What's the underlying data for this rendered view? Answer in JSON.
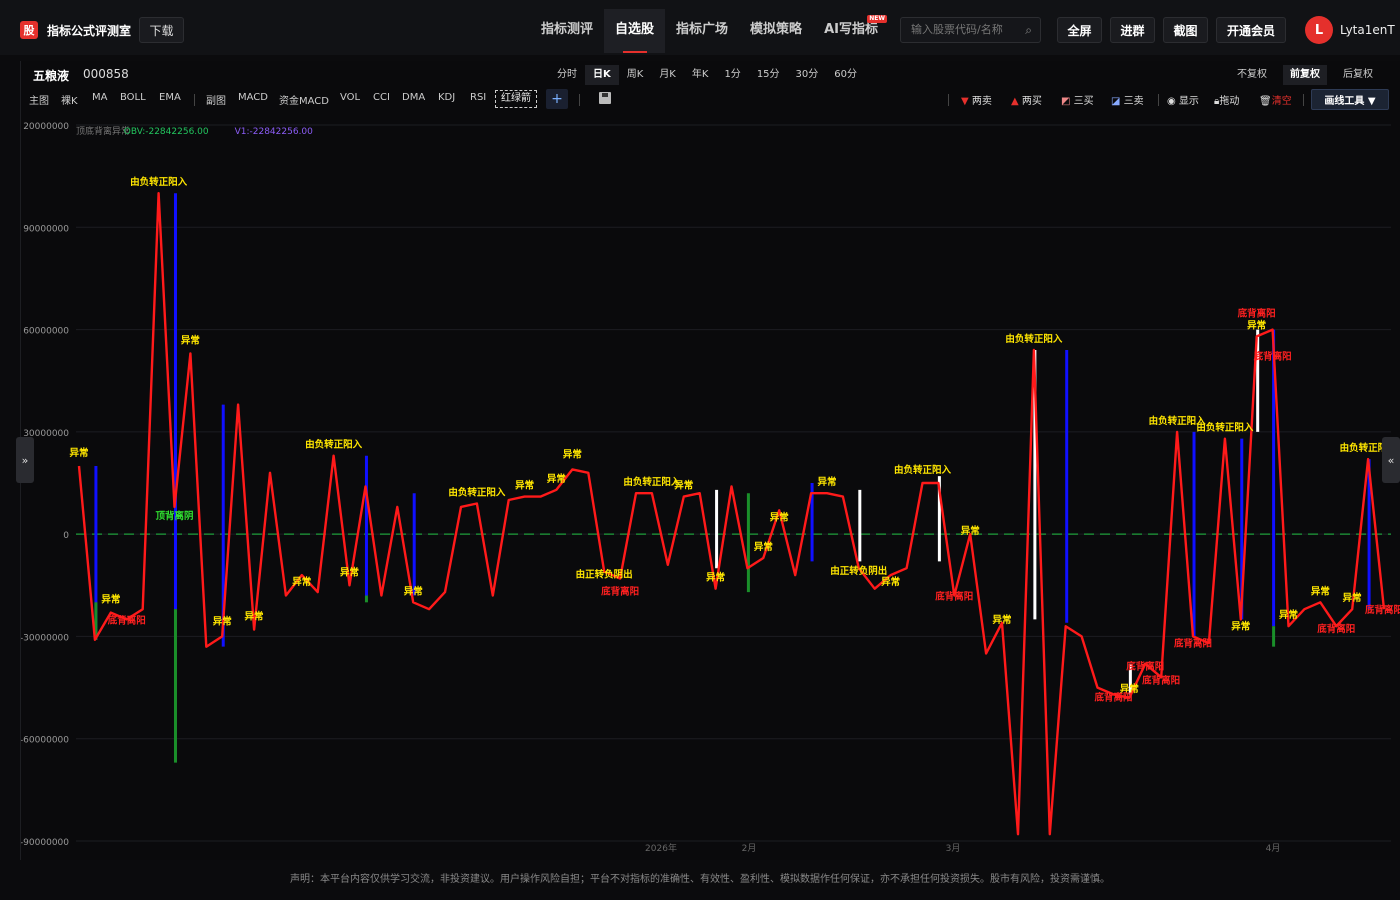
{
  "header": {
    "logo_char": "股",
    "app_title": "指标公式评测室",
    "download": "下载",
    "nav": [
      {
        "label": "指标测评",
        "active": false,
        "badge": ""
      },
      {
        "label": "自选股",
        "active": true,
        "badge": ""
      },
      {
        "label": "指标广场",
        "active": false,
        "badge": ""
      },
      {
        "label": "模拟策略",
        "active": false,
        "badge": ""
      },
      {
        "label": "AI写指标",
        "active": false,
        "badge": "NEW"
      }
    ],
    "search_placeholder": "输入股票代码/名称",
    "fullscreen": "全屏",
    "join_group": "进群",
    "screenshot": "截图",
    "vip": "开通会员",
    "avatar_letter": "L",
    "username": "Lyta1enT"
  },
  "stock": {
    "name": "五粮液",
    "code": "000858"
  },
  "periods": [
    "分时",
    "日K",
    "周K",
    "月K",
    "年K",
    "1分",
    "15分",
    "30分",
    "60分"
  ],
  "active_period": "日K",
  "fq": [
    "不复权",
    "前复权",
    "后复权"
  ],
  "active_fq": "前复权",
  "tools_left": [
    "主图",
    "裸K",
    "MA",
    "BOLL",
    "EMA",
    "副图",
    "MACD",
    "资金MACD",
    "VOL",
    "CCI",
    "DMA",
    "KDJ",
    "RSI"
  ],
  "tool_dashed": "红绿箭",
  "tools_right": {
    "two_sell": "两卖",
    "two_buy": "两买",
    "three_buy": "三买",
    "three_sell": "三卖",
    "show": "显示",
    "drag": "拖动",
    "clear": "清空",
    "draw_tools": "画线工具 ▼"
  },
  "chart_data": {
    "type": "line",
    "legend": [
      {
        "name": "顶底背离异常",
        "color": "#777777"
      },
      {
        "name": "OBV:-22842256.00",
        "color": "#22c55e"
      },
      {
        "name": "V1:-22842256.00",
        "color": "#8b5cf6"
      }
    ],
    "y_ticks": [
      "20000000",
      "90000000",
      "60000000",
      "30000000",
      "0",
      "-30000000",
      "-60000000",
      "-90000000"
    ],
    "x_ticks": [
      "2026年",
      "2月",
      "3月",
      "4月"
    ],
    "ylim": [
      -90000000,
      120000000
    ],
    "series": [
      {
        "name": "OBV",
        "color": "#e5302c",
        "values": [
          20000000,
          -31000000,
          -23000000,
          -25000000,
          -22000000,
          100000000,
          8000000,
          53000000,
          -33000000,
          -30000000,
          38000000,
          -28000000,
          18000000,
          -18000000,
          -12000000,
          -17000000,
          23000000,
          -15000000,
          14000000,
          -18000000,
          8000000,
          -20000000,
          -22000000,
          -17000000,
          8000000,
          9000000,
          -18000000,
          10000000,
          11000000,
          11000000,
          13000000,
          19000000,
          18000000,
          -11000000,
          -13000000,
          12000000,
          12000000,
          -9000000,
          11000000,
          12000000,
          -16000000,
          14000000,
          -10000000,
          -7000000,
          7000000,
          -12000000,
          12000000,
          12000000,
          11000000,
          -10000000,
          -16000000,
          -12000000,
          -10000000,
          15000000,
          15000000,
          -18000000,
          0,
          -35000000,
          -26000000,
          -88000000,
          54000000,
          -88000000,
          -27000000,
          -30000000,
          -45000000,
          -47000000,
          -48000000,
          -38000000,
          -42000000,
          30000000,
          -30000000,
          -32000000,
          28000000,
          -25000000,
          58000000,
          60000000,
          -27000000,
          -22000000,
          -20000000,
          -27000000,
          -22000000,
          22000000,
          -22000000
        ]
      },
      {
        "name": "V1",
        "color": "#22c55e",
        "values": []
      }
    ],
    "annotations": [
      "由负转正阳入",
      "异常",
      "底背离阳",
      "顶背离阴",
      "由正转负阴出"
    ]
  },
  "footer": "声明：本平台内容仅供学习交流，非投资建议。用户操作风险自担；平台不对指标的准确性、有效性、盈利性、模拟数据作任何保证，亦不承担任何投资损失。股市有风险，投资需谨慎。"
}
